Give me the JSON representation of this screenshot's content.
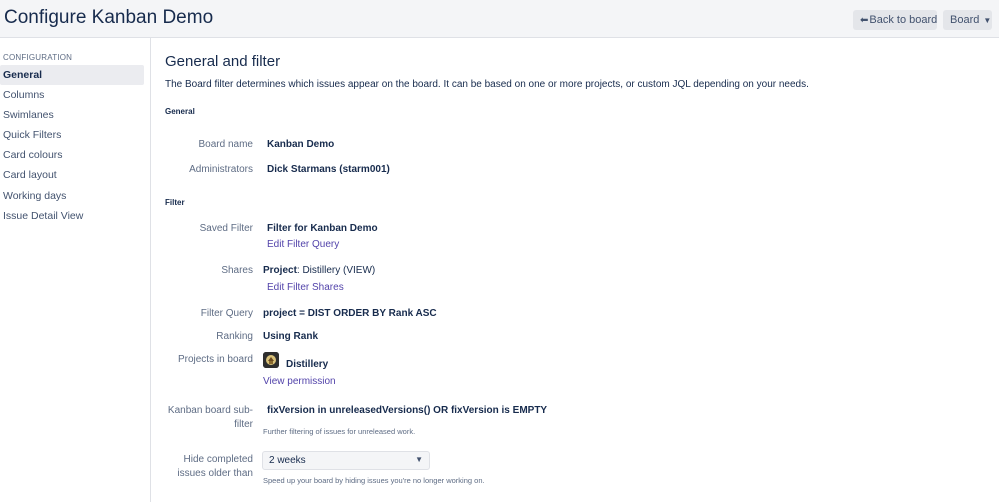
{
  "header": {
    "title": "Configure Kanban Demo",
    "back_button": "Back to board",
    "board_button": "Board"
  },
  "sidebar": {
    "heading": "CONFIGURATION",
    "items": [
      {
        "label": "General",
        "active": true
      },
      {
        "label": "Columns"
      },
      {
        "label": "Swimlanes"
      },
      {
        "label": "Quick Filters"
      },
      {
        "label": "Card colours"
      },
      {
        "label": "Card layout"
      },
      {
        "label": "Working days"
      },
      {
        "label": "Issue Detail View"
      }
    ]
  },
  "main": {
    "title": "General and filter",
    "description": "The Board filter determines which issues appear on the board. It can be based on one or more projects, or custom JQL depending on your needs.",
    "general_section": "General",
    "board_name_label": "Board name",
    "board_name_value": "Kanban Demo",
    "administrators_label": "Administrators",
    "administrators_value": "Dick Starmans (starm001)",
    "filter_section": "Filter",
    "saved_filter_label": "Saved Filter",
    "saved_filter_value": "Filter for Kanban Demo",
    "edit_filter_query": "Edit Filter Query",
    "shares_label": "Shares",
    "shares_project": "Project",
    "shares_value": ": Distillery (VIEW)",
    "edit_filter_shares": "Edit Filter Shares",
    "filter_query_label": "Filter Query",
    "filter_query_value": "project = DIST ORDER BY Rank ASC",
    "ranking_label": "Ranking",
    "ranking_value": "Using Rank",
    "projects_label": "Projects in board",
    "project_name": "Distillery",
    "view_permission": "View permission",
    "subfilter_label": "Kanban board sub-filter",
    "subfilter_value": "fixVersion in unreleasedVersions() OR fixVersion is EMPTY",
    "subfilter_hint": "Further filtering of issues for unreleased work.",
    "hide_label": "Hide completed issues older than",
    "hide_value": "2 weeks",
    "hide_hint": "Speed up your board by hiding issues you're no longer working on."
  },
  "icons": {
    "back": "arrow-left-icon",
    "board_menu": "chevron-down-icon",
    "project_avatar": "project-avatar-icon",
    "select_chevron": "chevron-down-icon"
  },
  "colors": {
    "link": "#5243aa",
    "text": "#172b4d",
    "muted": "#5e6c84",
    "topbar_bg": "#f4f5f7"
  }
}
